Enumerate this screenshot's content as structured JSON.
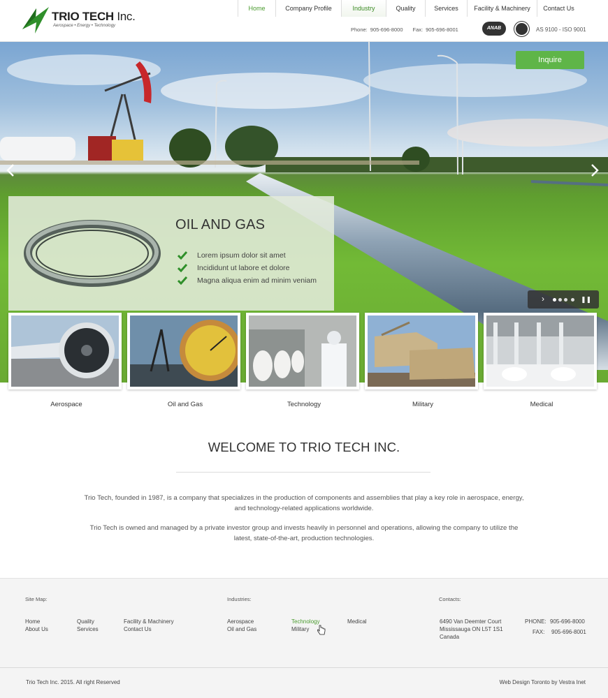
{
  "brand": {
    "name": "TRIO TECH",
    "suffix": " Inc.",
    "tagline": "Aerospace • Energy • Technology",
    "color_green": "#2f8f2a",
    "icon": "lightning-bolt-logo"
  },
  "nav": {
    "items": [
      "Home",
      "Company Profile",
      "Industry",
      "Quality",
      "Services",
      "Facility & Machinery",
      "Contact Us"
    ],
    "active": "Home",
    "highlighted": "Industry"
  },
  "header": {
    "phone_label": "Phone:",
    "phone": "905-696-8000",
    "fax_label": "Fax:",
    "fax": "905-696-8001",
    "cert_anab": "ANAB",
    "certifications": "AS 9100 - ISO 9001"
  },
  "hero": {
    "inquire_label": "Inquire",
    "slide_title": "OIL AND GAS",
    "bullets": [
      "Lorem ipsum dolor sit amet",
      "Incididunt ut labore et dolore",
      "Magna aliqua enim ad minim veniam"
    ],
    "prev_icon": "chevron-left-icon",
    "next_icon": "chevron-right-icon",
    "accent": "#5fb548"
  },
  "industries": [
    {
      "label": "Aerospace",
      "icon": "jet-engine-image"
    },
    {
      "label": "Oil and Gas",
      "icon": "pressure-gauge-image"
    },
    {
      "label": "Technology",
      "icon": "lab-scientist-image"
    },
    {
      "label": "Military",
      "icon": "tank-image"
    },
    {
      "label": "Medical",
      "icon": "medical-machinery-image"
    }
  ],
  "welcome": {
    "title": "WELCOME TO TRIO TECH INC.",
    "p1_line1": "Trio Tech, founded in 1987, is a company that specializes in the production of components and assemblies that play a key role in aerospace, energy,",
    "p1_line2": "and technology-related applications worldwide.",
    "p2_line1": "Trio Tech is owned and managed by a private investor group and invests heavily in personnel and operations, allowing the company to utilize the",
    "p2_line2": "latest, state-of-the-art, production technologies."
  },
  "footer": {
    "sitemap_heading": "Site Map:",
    "sitemap": [
      "Home",
      "About Us",
      "Quality",
      "Services",
      "Facility & Machinery",
      "Contact Us"
    ],
    "industries_heading": "Industries:",
    "industries": [
      "Aerospace",
      "Oil and Gas",
      "Technology",
      "Military",
      "Medical"
    ],
    "industries_active": "Technology",
    "contacts_heading": "Contacts:",
    "address": [
      "6490 Van Deemter Court",
      "Mississauga ON L5T 1S1",
      "Canada"
    ],
    "phone_label": "PHONE:",
    "phone": "905-696-8000",
    "fax_label": "FAX:",
    "fax": "905-696-8001",
    "copyright": "Trio Tech Inc. 2015. All right Reserved",
    "credit": "Web Design Toronto by Vestra Inet"
  }
}
